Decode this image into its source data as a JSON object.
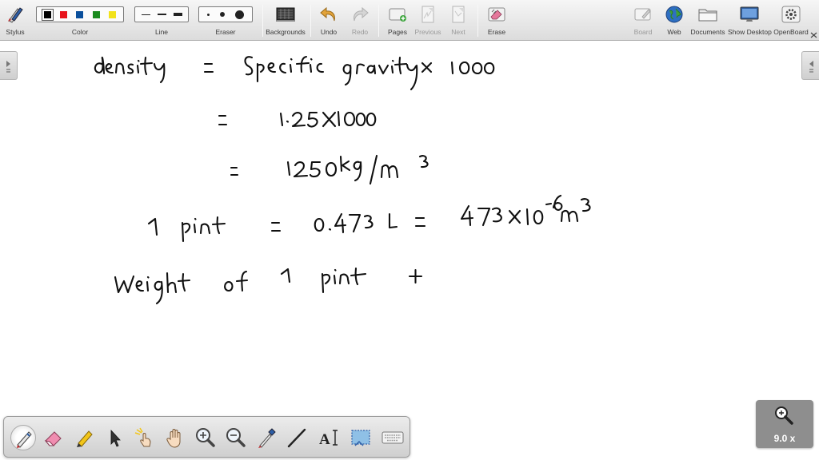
{
  "toolbar": {
    "stylus_label": "Stylus",
    "color_label": "Color",
    "line_label": "Line",
    "eraser_label": "Eraser",
    "backgrounds_label": "Backgrounds",
    "undo_label": "Undo",
    "redo_label": "Redo",
    "pages_label": "Pages",
    "previous_label": "Previous",
    "next_label": "Next",
    "erase_label": "Erase",
    "board_label": "Board",
    "web_label": "Web",
    "documents_label": "Documents",
    "show_desktop_label": "Show Desktop",
    "openboard_label": "OpenBoard",
    "colors": [
      "#000000",
      "#e8131b",
      "#0a4f9c",
      "#1a8a1e",
      "#f2e21a"
    ],
    "selected_color": "#000000"
  },
  "zoom": {
    "level_text": "9.0 x"
  },
  "icons": {
    "stylus": "stylus-icon",
    "backgrounds": "backgrounds-icon",
    "undo": "undo-arrow-icon",
    "redo": "redo-arrow-icon",
    "pages": "add-page-icon",
    "previous": "previous-page-icon",
    "next": "next-page-icon",
    "erase": "erase-board-icon",
    "board": "board-icon",
    "web": "globe-icon",
    "documents": "folder-icon",
    "show_desktop": "monitor-icon",
    "openboard": "gear-icon",
    "zoom": "zoom-magnifier-icon"
  },
  "palette_tools": [
    "pen-tool-icon",
    "eraser-tool-icon",
    "marker-tool-icon",
    "pointer-arrow-icon",
    "laser-pointer-icon",
    "hand-pan-icon",
    "zoom-in-icon",
    "zoom-out-icon",
    "pipette-icon",
    "line-tool-icon",
    "text-tool-icon",
    "capture-tool-icon",
    "keyboard-icon"
  ]
}
